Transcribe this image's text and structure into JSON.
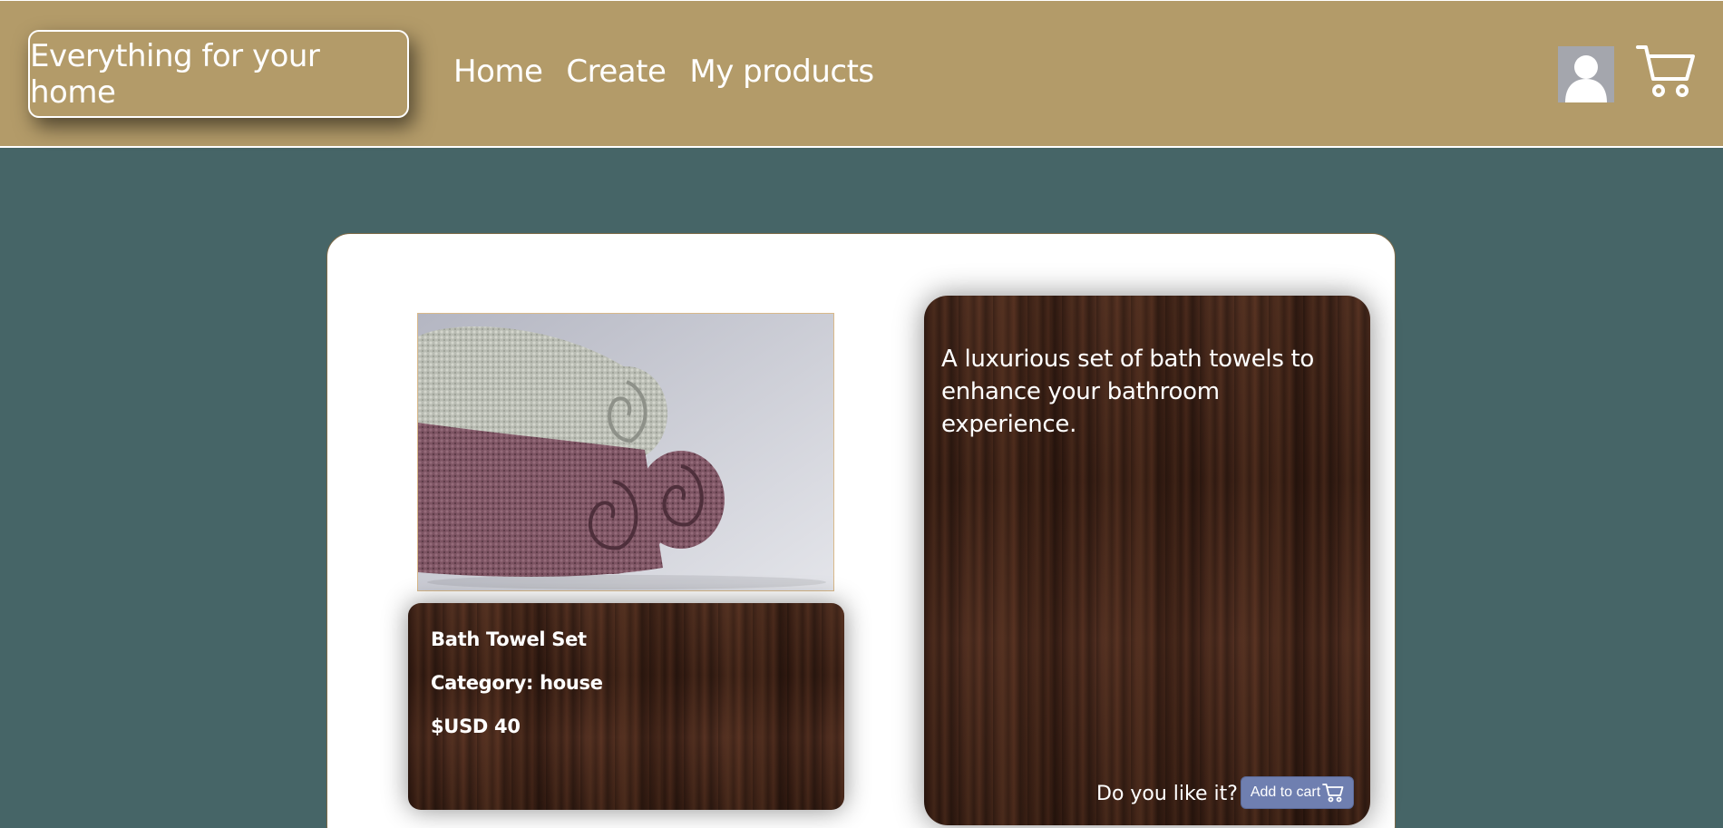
{
  "header": {
    "brand": "Everything for your home",
    "nav": [
      "Home",
      "Create",
      "My products"
    ],
    "icons": [
      "user-icon",
      "cart-icon"
    ]
  },
  "product": {
    "image": "towels-image",
    "name": "Bath Towel Set",
    "category": "Category: house",
    "price": "$USD 40",
    "description": "A luxurious set of bath towels to enhance your bathroom experience.",
    "like_prompt": "Do you like it?",
    "add_to_cart_label": "Add to cart"
  },
  "colors": {
    "header": "#b39b69",
    "background": "#466567",
    "wood": "#4a2a1d",
    "button": "#6f7fb0"
  }
}
